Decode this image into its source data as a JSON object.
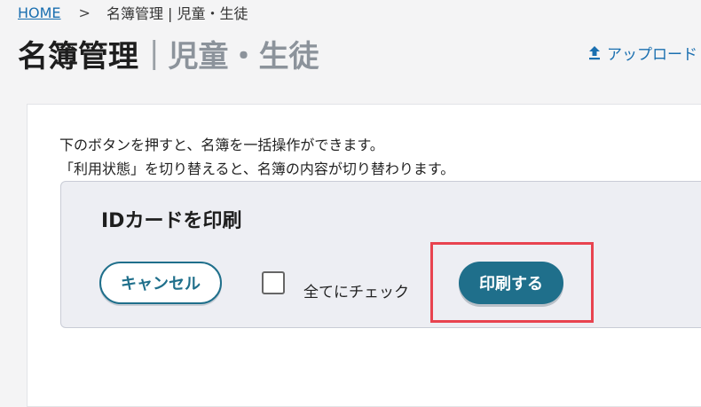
{
  "breadcrumb": {
    "home": "HOME",
    "separator": ">",
    "current": "名簿管理 | 児童・生徒"
  },
  "title": {
    "main": "名簿管理",
    "divider": "|",
    "sub": "児童・生徒"
  },
  "upload": {
    "label": "アップロード",
    "icon": "upload-icon"
  },
  "description": {
    "line1": "下のボタンを押すと、名簿を一括操作ができます。",
    "line2": "「利用状態」を切り替えると、名簿の内容が切り替わります。"
  },
  "action_box": {
    "title": "IDカードを印刷",
    "cancel_label": "キャンセル",
    "check_all_label": "全てにチェック",
    "check_all_checked": false,
    "print_label": "印刷する"
  },
  "colors": {
    "accent": "#1f6f8b",
    "link": "#1a6fb0",
    "highlight": "#e8434f"
  }
}
